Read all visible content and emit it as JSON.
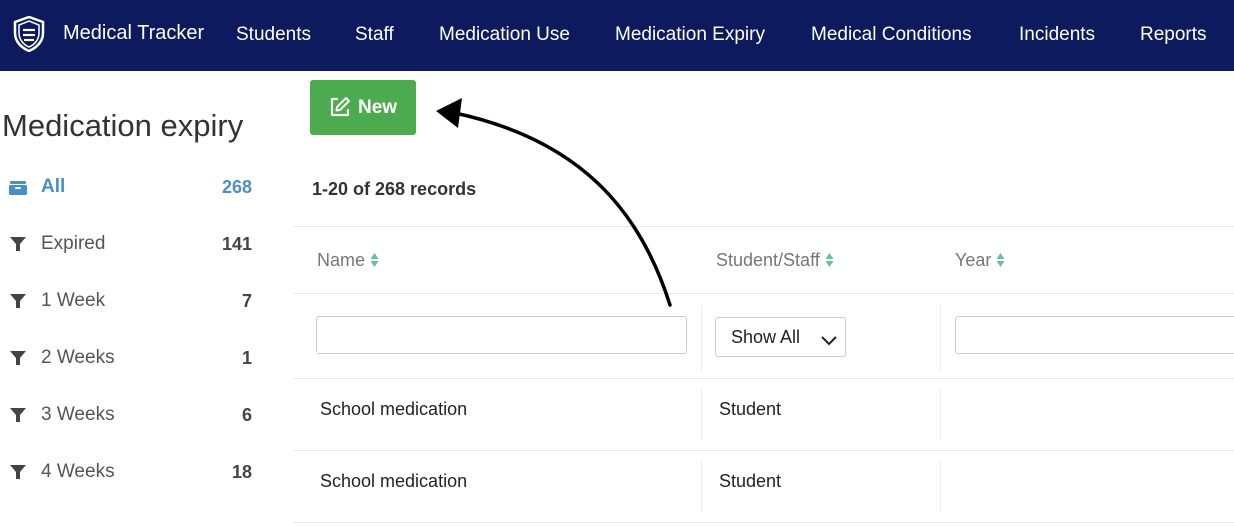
{
  "nav": {
    "brand": "Medical Tracker",
    "items": [
      "Students",
      "Staff",
      "Medication Use",
      "Medication Expiry",
      "Medical Conditions",
      "Incidents",
      "Reports"
    ]
  },
  "sidebar": {
    "title": "Medication expiry",
    "items": [
      {
        "label": "All",
        "count": "268",
        "icon": "inbox-icon",
        "active": true
      },
      {
        "label": "Expired",
        "count": "141",
        "icon": "filter-icon"
      },
      {
        "label": "1 Week",
        "count": "7",
        "icon": "filter-icon"
      },
      {
        "label": "2 Weeks",
        "count": "1",
        "icon": "filter-icon"
      },
      {
        "label": "3 Weeks",
        "count": "6",
        "icon": "filter-icon"
      },
      {
        "label": "4 Weeks",
        "count": "18",
        "icon": "filter-icon"
      }
    ]
  },
  "toolbar": {
    "new_label": "New"
  },
  "records_summary": "1-20 of 268 records",
  "table": {
    "columns": [
      "Name",
      "Student/Staff",
      "Year"
    ],
    "filter": {
      "select_value": "Show All"
    },
    "rows": [
      {
        "name": "School medication",
        "type": "Student",
        "year": ""
      },
      {
        "name": "School medication",
        "type": "Student",
        "year": ""
      }
    ]
  },
  "colors": {
    "nav_bg": "#0d1a5e",
    "accent": "#4a90c8",
    "new_button": "#4caa4f",
    "sort_arrow": "#6bbf9a"
  }
}
